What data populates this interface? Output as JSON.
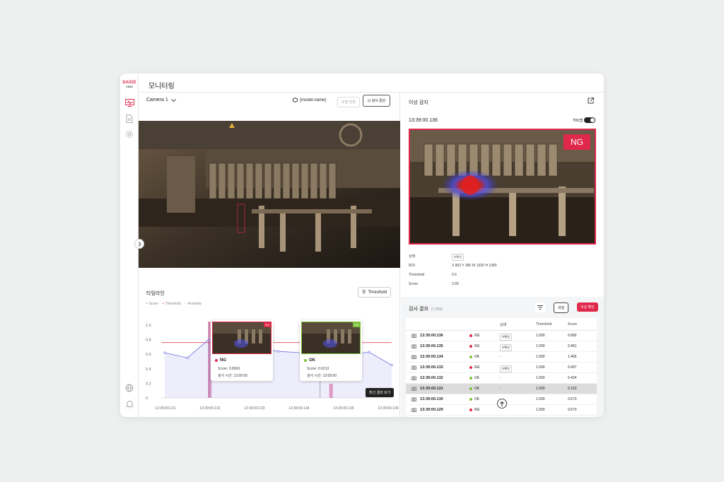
{
  "app": {
    "logo_line1": "SAIGE",
    "logo_line2": "VIMS",
    "page_title": "모니터링"
  },
  "camera": {
    "selected": "Camera 1",
    "model_name": "{model-name}",
    "btn_model": "모델 변경",
    "btn_check": "검사 중단"
  },
  "timeline": {
    "title": "타임라인",
    "threshold_button": "Threshold",
    "legend": [
      "Score",
      "Threshold",
      "Anomaly"
    ],
    "y_ticks": [
      "1.0",
      "0.8",
      "0.6",
      "0.4",
      "0.2",
      "0"
    ],
    "x_ticks": [
      "13:39:00.131",
      "13:39:00.132",
      "13:39:00.133",
      "13:39:00.134",
      "13:39:00.135",
      "13:39:00.136"
    ]
  },
  "chart_data": {
    "type": "line",
    "title": "",
    "x": [
      "13:39:00.131",
      "13:39:00.131",
      "13:39:00.132",
      "13:39:00.1325",
      "13:39:00.133",
      "13:39:00.1335",
      "13:39:00.134",
      "13:39:00.1345",
      "13:39:00.135",
      "13:39:00.1355",
      "13:39:00.136"
    ],
    "series": [
      {
        "name": "Score",
        "color": "#6f6fe0",
        "values": [
          0.62,
          0.55,
          0.82,
          0.66,
          0.68,
          0.64,
          0.62,
          0.63,
          0.59,
          0.63,
          0.45
        ]
      },
      {
        "name": "Threshold",
        "color": "#e0284a",
        "values": [
          0.76,
          0.76,
          0.76,
          0.76,
          0.76,
          0.76,
          0.76,
          0.76,
          0.76,
          0.76,
          0.76
        ]
      }
    ],
    "ylim": [
      0,
      1.0
    ],
    "grid": false,
    "legend": "top-left"
  },
  "tooltips": [
    {
      "badge": "NG",
      "status": "NG",
      "score": "Score: 0.8963",
      "time": "검사 시간: 13:09:00",
      "color": "#e0284a"
    },
    {
      "badge": "OK",
      "status": "OK",
      "score": "Score: 0.6213",
      "time": "검사 시간: 13:09:00",
      "color": "#7cc23a"
    }
  ],
  "detection": {
    "title": "이상 감지",
    "time": "13:39:00.136",
    "heatmap_label": "히트맵",
    "result": "NG",
    "info": {
      "status_label": "상태",
      "status_value": "미확인",
      "roi_label": "ROI",
      "roi_value": "X 863  Y 380  W 1920  H 1080",
      "threshold_label": "Threshold",
      "threshold_value": "0.6",
      "score_label": "Score",
      "score_value": "3.68"
    }
  },
  "results": {
    "title": "검사 결과",
    "count": "(7,200)",
    "btn_past": "과검",
    "btn_anomaly": "이상 확인",
    "headers": {
      "status": "상태",
      "threshold": "Threshold",
      "score": "Score"
    },
    "rows": [
      {
        "time": "13:39:00.136",
        "status": "NG",
        "check": "미확인",
        "threshold": "1.000",
        "score": "0.682"
      },
      {
        "time": "13:39:00.135",
        "status": "NG",
        "check": "미확인",
        "threshold": "1.000",
        "score": "0.461"
      },
      {
        "time": "13:39:00.134",
        "status": "OK",
        "check": "-",
        "threshold": "1.000",
        "score": "1.465"
      },
      {
        "time": "13:39:00.133",
        "status": "NG",
        "check": "미확인",
        "threshold": "1.000",
        "score": "0.457"
      },
      {
        "time": "13:39:00.132",
        "status": "OK",
        "check": "-",
        "threshold": "1.000",
        "score": "0.424"
      },
      {
        "time": "13:39:00.131",
        "status": "OK",
        "check": "-",
        "threshold": "1.000",
        "score": "0.163"
      },
      {
        "time": "13:39:00.130",
        "status": "OK",
        "check": "-",
        "threshold": "1.000",
        "score": "0.673"
      },
      {
        "time": "13:39:00.129",
        "status": "NG",
        "check": "",
        "threshold": "1.000",
        "score": "0.673"
      }
    ],
    "hover_tip": "최신 결과 보기"
  },
  "colors": {
    "accent": "#e0284a",
    "ok": "#7cc23a",
    "score": "#6f6fe0"
  }
}
